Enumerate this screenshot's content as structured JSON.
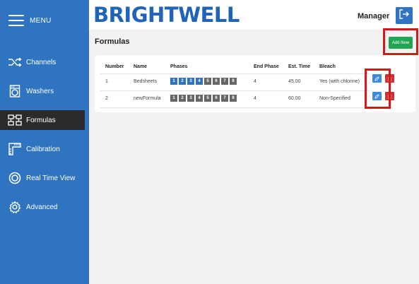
{
  "sidebar": {
    "menu_label": "MENU",
    "items": [
      {
        "label": "Channels",
        "icon": "shuffle-icon"
      },
      {
        "label": "Washers",
        "icon": "washer-icon"
      },
      {
        "label": "Formulas",
        "icon": "formula-icon",
        "active": true
      },
      {
        "label": "Calibration",
        "icon": "ruler-icon"
      },
      {
        "label": "Real Time View",
        "icon": "target-icon"
      },
      {
        "label": "Advanced",
        "icon": "gear-icon"
      }
    ]
  },
  "header": {
    "logo": "BRIGHTWELL",
    "user": "Manager"
  },
  "main": {
    "title": "Formulas",
    "add_new_label": "Add New",
    "table": {
      "columns": [
        "Number",
        "Name",
        "Phases",
        "End Phase",
        "Est. Time",
        "Bleach"
      ],
      "rows": [
        {
          "number": "1",
          "name": "Bedsheets",
          "phases": [
            "1",
            "2",
            "3",
            "4",
            "5",
            "6",
            "7",
            "8"
          ],
          "phase_active": [
            true,
            true,
            true,
            true,
            false,
            false,
            false,
            false
          ],
          "end_phase": "4",
          "est_time": "45.00",
          "bleach": "Yes (with chlorine)"
        },
        {
          "number": "2",
          "name": "newFormula",
          "phases": [
            "1",
            "2",
            "3",
            "4",
            "5",
            "6",
            "7",
            "8"
          ],
          "phase_active": [
            false,
            false,
            false,
            false,
            false,
            false,
            false,
            false
          ],
          "end_phase": "4",
          "est_time": "60.00",
          "bleach": "Non-Specified"
        }
      ]
    }
  },
  "colors": {
    "sidebar": "#2f74c0",
    "active_item": "#2b2b2b",
    "logo": "#1f64b8",
    "add_button": "#23a455",
    "edit_button": "#3c8be0",
    "delete_button": "#d33131",
    "highlight": "#d11a1a",
    "phase_active": "#2f74c0",
    "phase_inactive": "#666666"
  }
}
